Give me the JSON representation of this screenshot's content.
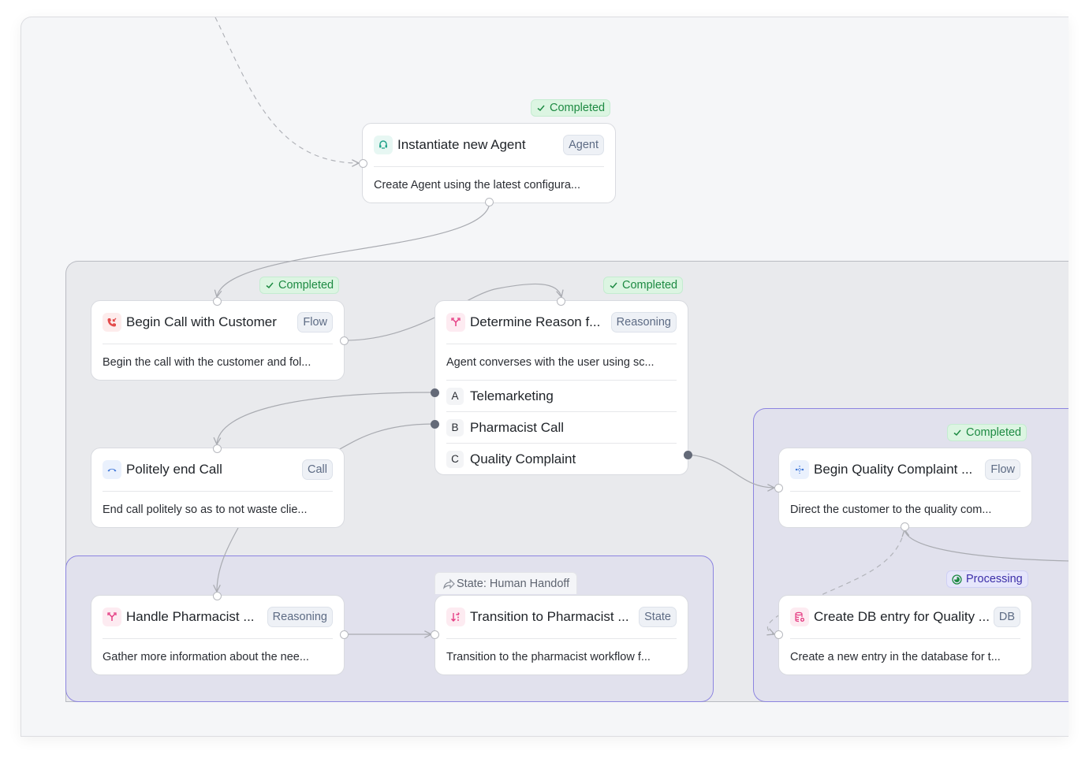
{
  "colors": {
    "completed_text": "#1d8a42",
    "completed_bg": "#dcf5e2",
    "processing_text": "#3b2ea8",
    "processing_bg": "#e6e6fb",
    "group_border": "#8c84e0",
    "edge": "#a9abb1",
    "handle_filled": "#646a78"
  },
  "groups": [
    {
      "id": "main",
      "label": ""
    },
    {
      "id": "pharmacist",
      "label": ""
    },
    {
      "id": "quality",
      "label": ""
    }
  ],
  "nodes": [
    {
      "id": "instantiate-agent",
      "title": "Instantiate new Agent",
      "type": "Agent",
      "description": "Create Agent using the latest configura...",
      "icon": "agent-headset-icon",
      "status": "Completed"
    },
    {
      "id": "begin-call",
      "title": "Begin Call with Customer",
      "type": "Flow",
      "description": "Begin the call with the customer and fol...",
      "icon": "phone-incoming-icon",
      "status": "Completed"
    },
    {
      "id": "determine-reason",
      "title": "Determine Reason f...",
      "type": "Reasoning",
      "description": "Agent converses with the user using sc...",
      "icon": "split-branch-icon",
      "status": "Completed",
      "options": [
        {
          "key": "A",
          "label": "Telemarketing"
        },
        {
          "key": "B",
          "label": "Pharmacist Call"
        },
        {
          "key": "C",
          "label": "Quality Complaint"
        }
      ]
    },
    {
      "id": "politely-end-call",
      "title": "Politely end Call",
      "type": "Call",
      "description": "End call politely so as to not waste clie...",
      "icon": "phone-hangup-icon",
      "status": ""
    },
    {
      "id": "handle-pharmacist",
      "title": "Handle Pharmacist ...",
      "type": "Reasoning",
      "description": "Gather more information about the nee...",
      "icon": "split-branch-icon",
      "status": ""
    },
    {
      "id": "transition-pharmacist",
      "title": "Transition to Pharmacist ...",
      "type": "State",
      "description": "Transition to the pharmacist workflow f...",
      "icon": "arrows-up-down-icon",
      "status": "",
      "state_label": "State: Human Handoff"
    },
    {
      "id": "begin-quality-complaint",
      "title": "Begin Quality Complaint ...",
      "type": "Flow",
      "description": "Direct the customer to the quality com...",
      "icon": "flow-dots-icon",
      "status": "Completed"
    },
    {
      "id": "create-db-entry",
      "title": "Create DB entry for Quality ...",
      "type": "DB",
      "description": "Create a new entry in the database for t...",
      "icon": "database-add-icon",
      "status": "Processing"
    }
  ]
}
